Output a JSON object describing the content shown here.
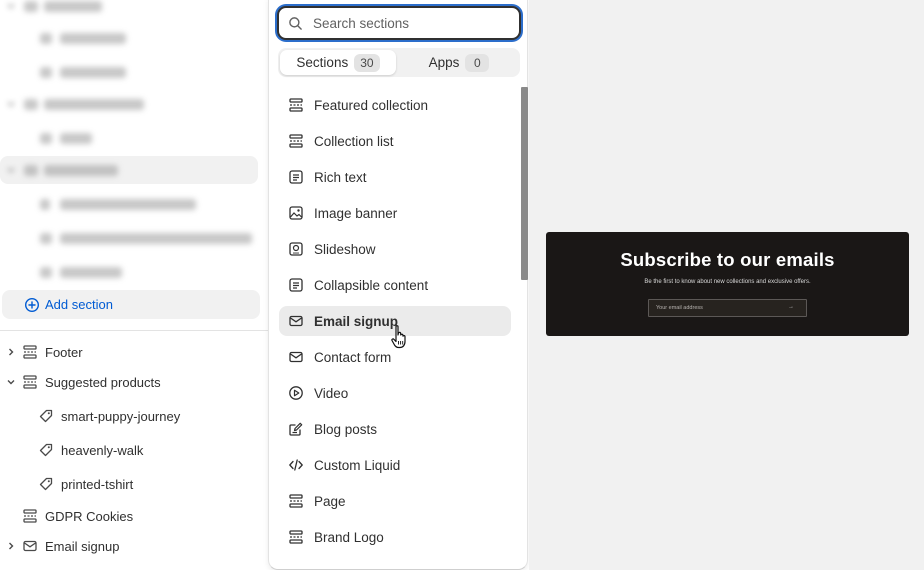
{
  "sidebar": {
    "add_section": "Add section",
    "footer": "Footer",
    "suggested_products": "Suggested products",
    "products": [
      "smart-puppy-journey",
      "heavenly-walk",
      "printed-tshirt"
    ],
    "gdpr_cookies": "GDPR Cookies",
    "email_signup": "Email signup"
  },
  "picker": {
    "search_placeholder": "Search sections",
    "tabs": [
      {
        "label": "Sections",
        "count": "30"
      },
      {
        "label": "Apps",
        "count": "0"
      }
    ],
    "items": [
      {
        "label": "Featured collection",
        "icon": "featured-collection-icon"
      },
      {
        "label": "Collection list",
        "icon": "collection-list-icon"
      },
      {
        "label": "Rich text",
        "icon": "rich-text-icon"
      },
      {
        "label": "Image banner",
        "icon": "image-banner-icon"
      },
      {
        "label": "Slideshow",
        "icon": "slideshow-icon"
      },
      {
        "label": "Collapsible content",
        "icon": "collapsible-content-icon"
      },
      {
        "label": "Email signup",
        "icon": "email-icon"
      },
      {
        "label": "Contact form",
        "icon": "email-icon"
      },
      {
        "label": "Video",
        "icon": "play-icon"
      },
      {
        "label": "Blog posts",
        "icon": "blog-posts-icon"
      },
      {
        "label": "Custom Liquid",
        "icon": "code-icon"
      },
      {
        "label": "Page",
        "icon": "page-icon"
      },
      {
        "label": "Brand Logo",
        "icon": "brand-logo-icon"
      }
    ]
  },
  "preview": {
    "title": "Subscribe to our emails",
    "description": "Be the first to know about new collections and exclusive offers.",
    "email_placeholder": "Your email address",
    "arrow": "→"
  },
  "colors": {
    "accent": "#005bd3",
    "focus_ring": "#2c6ecb",
    "banner_bg": "#1a1716",
    "preview_bg": "#f1f1f1"
  }
}
